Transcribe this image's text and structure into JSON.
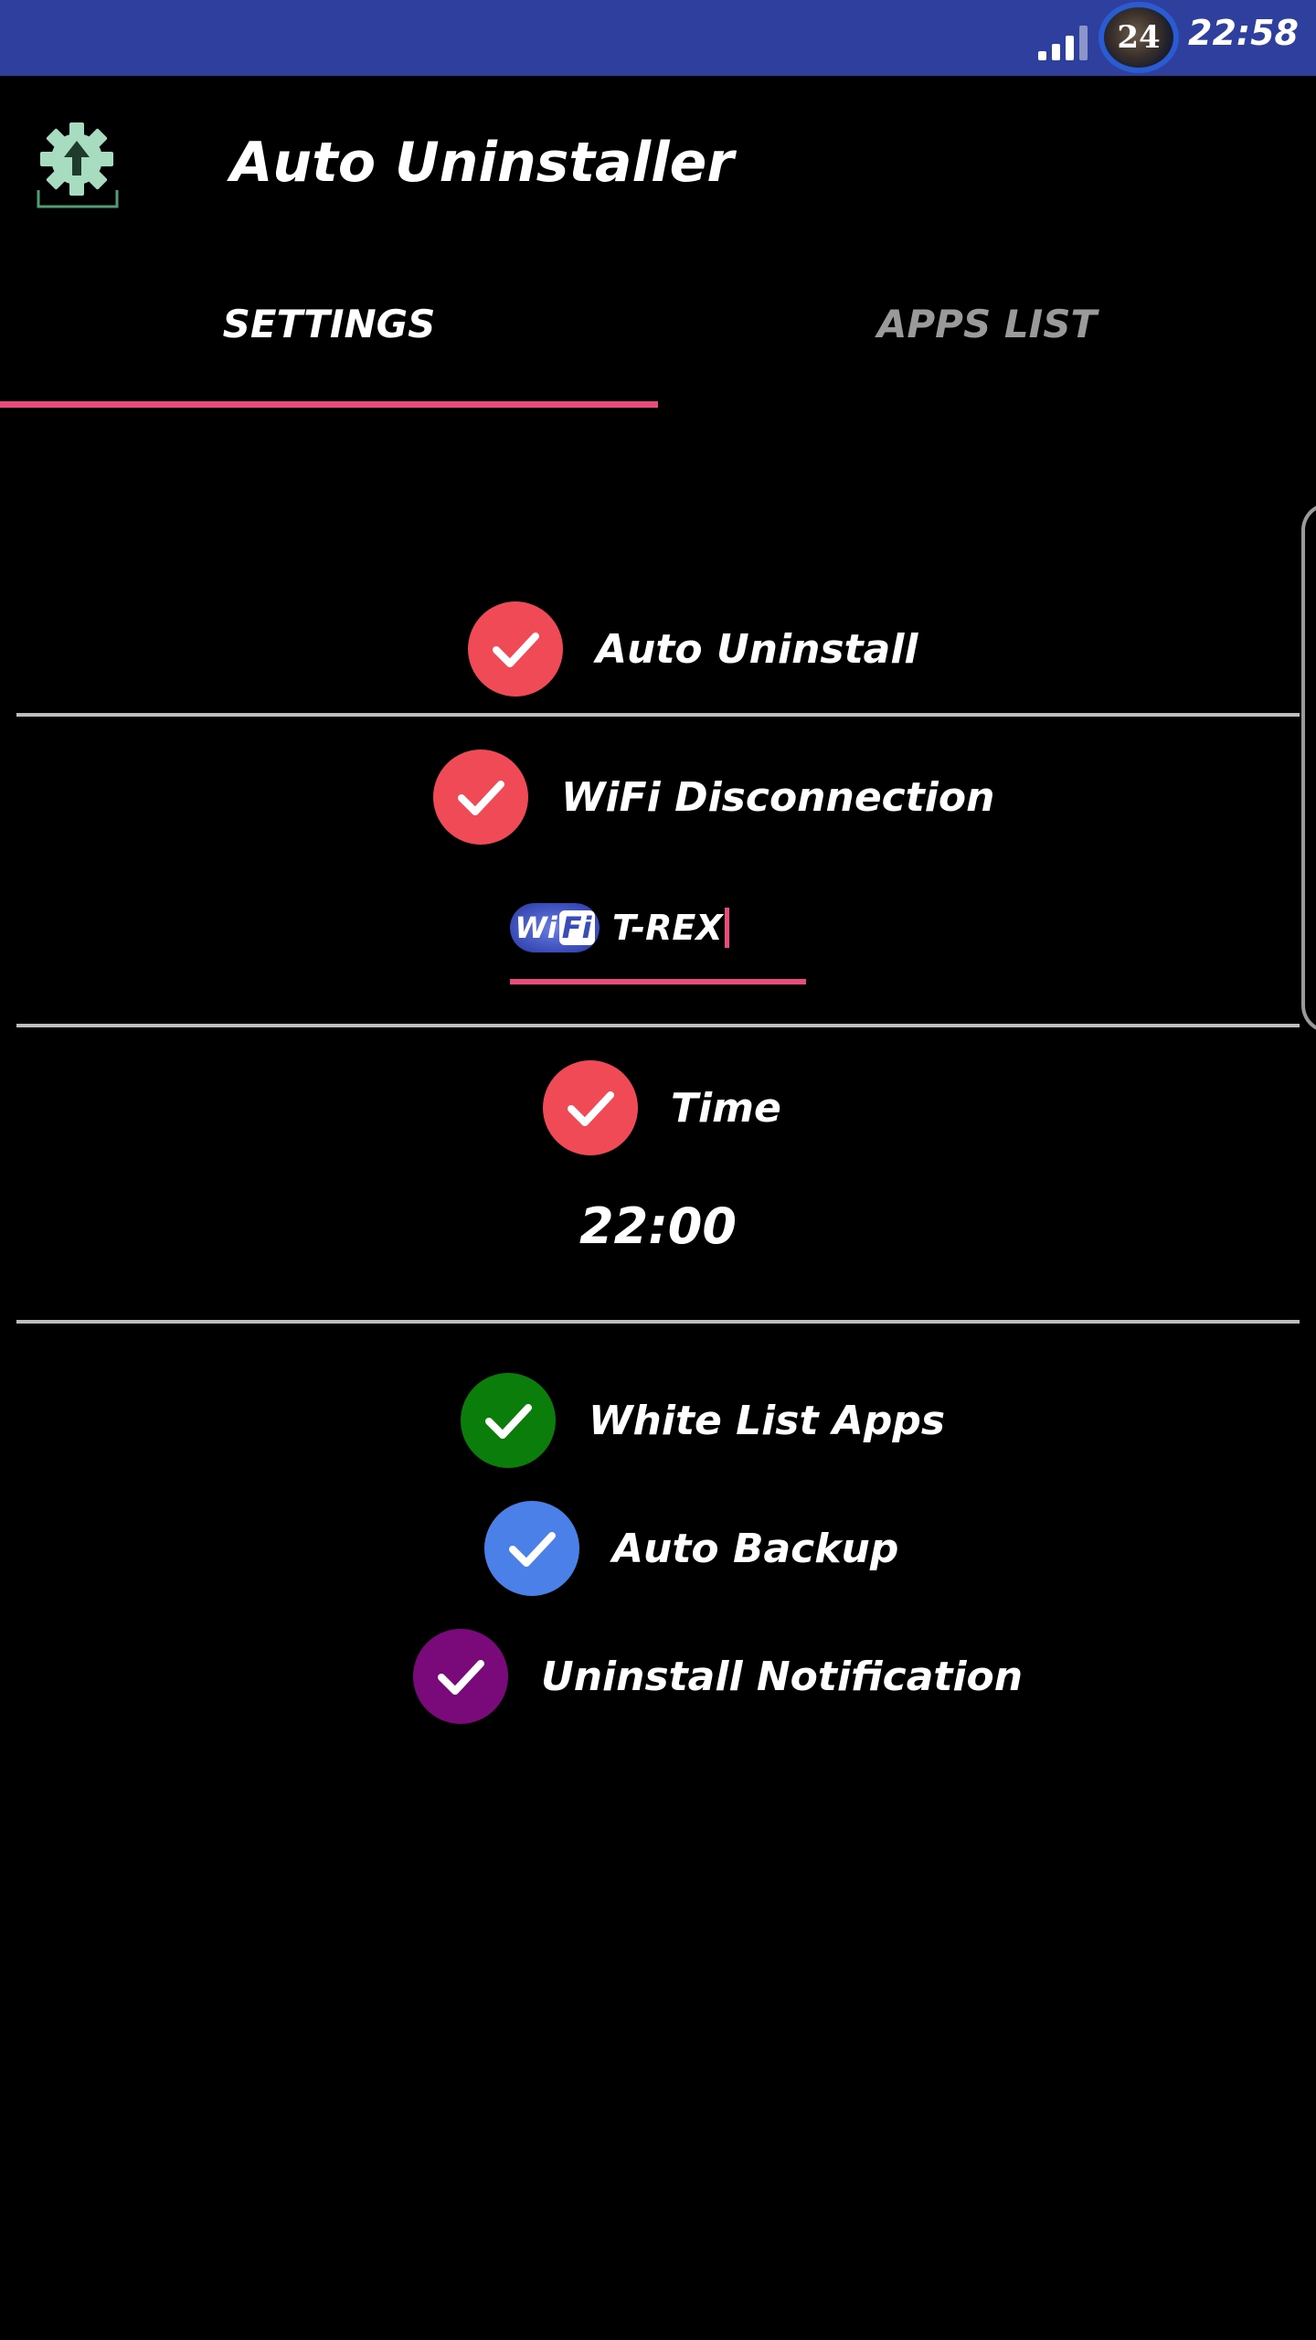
{
  "status_bar": {
    "badge_text": "24",
    "time": "22:58",
    "icons": [
      "signal-icon",
      "app-badge-icon"
    ],
    "color": "#2f3f9e"
  },
  "header": {
    "title": "Auto Uninstaller",
    "icon": "settings-upload-icon"
  },
  "tabs": [
    {
      "label": "SETTINGS",
      "active": true
    },
    {
      "label": "APPS LIST",
      "active": false
    }
  ],
  "settings": {
    "auto_uninstall": {
      "label": "Auto Uninstall",
      "checked": true,
      "color": "#f04a56"
    },
    "wifi_disconnection": {
      "label": "WiFi Disconnection",
      "checked": true,
      "color": "#f04a56"
    },
    "wifi_field": {
      "logo_text_wi": "Wi",
      "logo_text_fi": "Fi",
      "value": "T-REX"
    },
    "time": {
      "label": "Time",
      "checked": true,
      "color": "#f04a56",
      "value": "22:00"
    },
    "white_list_apps": {
      "label": "White List Apps",
      "checked": true,
      "color": "#0a7d0a"
    },
    "auto_backup": {
      "label": "Auto Backup",
      "checked": true,
      "color": "#4a80e8"
    },
    "uninstall_notification": {
      "label": "Uninstall Notification",
      "checked": true,
      "color": "#7a0a7a"
    }
  },
  "accent_color": "#ec4a7a"
}
